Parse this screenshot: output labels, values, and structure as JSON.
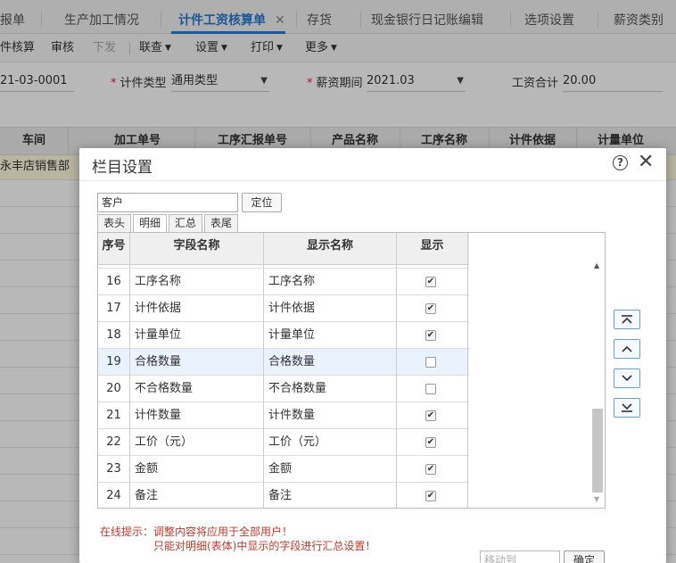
{
  "tabs": [
    {
      "label": "报单"
    },
    {
      "label": "生产加工情况"
    },
    {
      "label": "计件工资核算单",
      "active": true
    },
    {
      "label": "存货"
    },
    {
      "label": "现金银行日记账编辑"
    },
    {
      "label": "选项设置"
    },
    {
      "label": "薪资类别"
    }
  ],
  "tab_close_glyph": "✕",
  "toolbar": {
    "items": [
      "件核算",
      "审核",
      "下发",
      "联查",
      "设置",
      "打印",
      "更多"
    ]
  },
  "form": {
    "doc_no": "21-03-0001",
    "type_label": "计件类型",
    "type_value": "通用类型",
    "period_label": "薪资期间",
    "period_value": "2021.03",
    "total_label": "工资合计",
    "total_value": "20.00"
  },
  "grid": {
    "headers": [
      "车间",
      "加工单号",
      "工序汇报单号",
      "产品名称",
      "工序名称",
      "计件依据",
      "计量单位"
    ],
    "first_cell": "永丰店销售部"
  },
  "dialog": {
    "title": "栏目设置",
    "help_glyph": "?",
    "close_glyph": "✕",
    "search_value": "客户",
    "locate_label": "定位",
    "subtabs": [
      "表头",
      "明细",
      "汇总",
      "表尾"
    ],
    "columns": [
      "序号",
      "字段名称",
      "显示名称",
      "显示"
    ],
    "rows": [
      {
        "no": "16",
        "field": "工序名称",
        "display": "工序名称",
        "show": true
      },
      {
        "no": "17",
        "field": "计件依据",
        "display": "计件依据",
        "show": true
      },
      {
        "no": "18",
        "field": "计量单位",
        "display": "计量单位",
        "show": true
      },
      {
        "no": "19",
        "field": "合格数量",
        "display": "合格数量",
        "show": false
      },
      {
        "no": "20",
        "field": "不合格数量",
        "display": "不合格数量",
        "show": false
      },
      {
        "no": "21",
        "field": "计件数量",
        "display": "计件数量",
        "show": true
      },
      {
        "no": "22",
        "field": "工价（元）",
        "display": "工价（元）",
        "show": true
      },
      {
        "no": "23",
        "field": "金额",
        "display": "金额",
        "show": true
      },
      {
        "no": "24",
        "field": "备注",
        "display": "备注",
        "show": true
      }
    ],
    "check_glyph": "✔",
    "tip_line1": "在线提示：调整内容将应用于全部用户！",
    "tip_line2": "只能对明细(表体)中显示的字段进行汇总设置！",
    "moveto_placeholder": "移动到",
    "ok_label": "确定"
  }
}
